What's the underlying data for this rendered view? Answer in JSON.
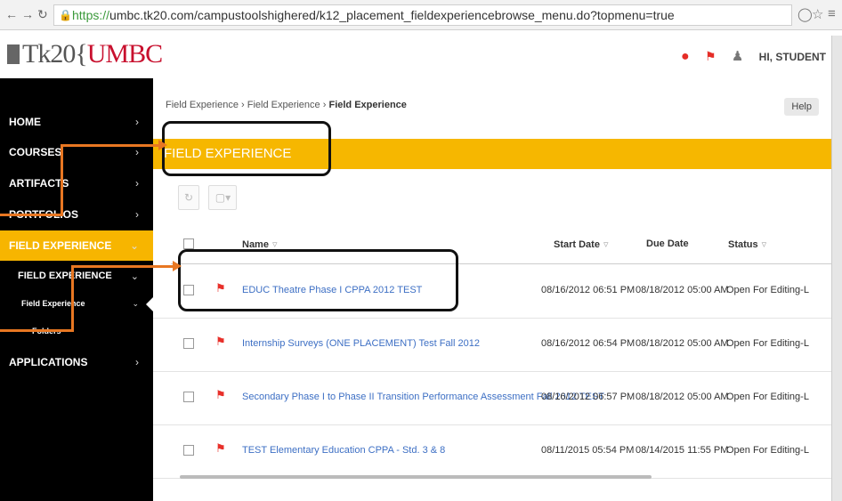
{
  "browser": {
    "url_protocol": "https://",
    "url_rest": "umbc.tk20.com/campustoolshighered/k12_placement_fieldexperiencebrowse_menu.do?topmenu=true"
  },
  "header": {
    "logo_prefix": "Tk20{",
    "logo_brand": "UMBC",
    "user_greeting": "HI, STUDENT"
  },
  "sidebar": {
    "items": [
      {
        "label": "HOME"
      },
      {
        "label": "COURSES"
      },
      {
        "label": "ARTIFACTS"
      },
      {
        "label": "PORTFOLIOS"
      },
      {
        "label": "FIELD EXPERIENCE"
      },
      {
        "label": "APPLICATIONS"
      }
    ],
    "sub_items": [
      {
        "label": "FIELD EXPERIENCE"
      },
      {
        "label": "Field Experience"
      },
      {
        "label": "Folders"
      }
    ]
  },
  "breadcrumb": {
    "crumb1": "Field Experience",
    "sep": "›",
    "crumb2": "Field Experience",
    "crumb3": "Field Experience"
  },
  "help_label": "Help",
  "page_title": "FIELD EXPERIENCE",
  "table": {
    "headers": {
      "name": "Name",
      "start_date": "Start Date",
      "due_date": "Due Date",
      "status": "Status"
    },
    "rows": [
      {
        "name": "EDUC Theatre Phase I CPPA 2012 TEST",
        "start": "08/16/2012 06:51 PM",
        "due": "08/18/2012 05:00 AM",
        "status": "Open For Editing-L"
      },
      {
        "name": "Internship Surveys (ONE PLACEMENT) Test Fall 2012",
        "start": "08/16/2012 06:54 PM",
        "due": "08/18/2012 05:00 AM",
        "status": "Open For Editing-L"
      },
      {
        "name": "Secondary Phase I to Phase II Transition Performance Assessment Fall 2012 TEST",
        "start": "08/16/2012 06:57 PM",
        "due": "08/18/2012 05:00 AM",
        "status": "Open For Editing-L"
      },
      {
        "name": "TEST Elementary Education CPPA - Std. 3 & 8",
        "start": "08/11/2015 05:54 PM",
        "due": "08/14/2015 11:55 PM",
        "status": "Open For Editing-L"
      }
    ]
  },
  "colors": {
    "accent": "#f6b700",
    "sidebar_bg": "#000000",
    "link": "#3d6fc4",
    "annotation": "#e87722"
  }
}
